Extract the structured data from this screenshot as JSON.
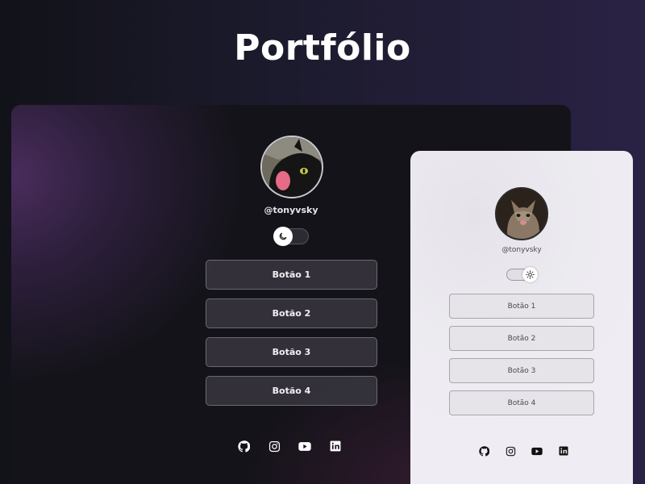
{
  "header": {
    "title": "Portfólio"
  },
  "dark_preview": {
    "username": "@tonyvsky",
    "theme_toggle": {
      "state": "dark",
      "icon": "moon-icon"
    },
    "buttons": [
      {
        "label": "Botão 1"
      },
      {
        "label": "Botão 2"
      },
      {
        "label": "Botão 3"
      },
      {
        "label": "Botão 4"
      }
    ],
    "social_icons": [
      "github-icon",
      "instagram-icon",
      "youtube-icon",
      "linkedin-icon"
    ]
  },
  "light_preview": {
    "username": "@tonyvsky",
    "theme_toggle": {
      "state": "light",
      "icon": "sun-icon"
    },
    "buttons": [
      {
        "label": "Botão 1"
      },
      {
        "label": "Botão 2"
      },
      {
        "label": "Botão 3"
      },
      {
        "label": "Botão 4"
      }
    ],
    "social_icons": [
      "github-icon",
      "instagram-icon",
      "youtube-icon",
      "linkedin-icon"
    ]
  },
  "colors": {
    "page_background": "#1b1a2c",
    "dark_card": "#141319",
    "dark_button": "#36343e",
    "light_card": "#ecebf0",
    "light_button": "#e6e3e9"
  }
}
